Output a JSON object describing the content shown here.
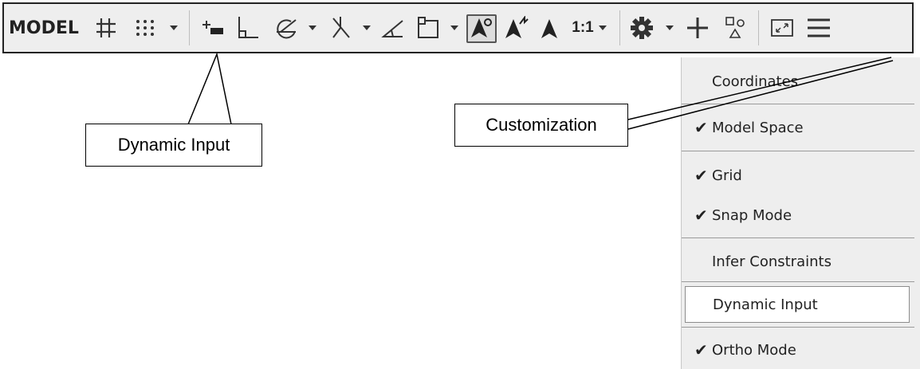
{
  "statusbar": {
    "model_label": "MODEL",
    "scale_label": "1:1",
    "tools": [
      {
        "name": "grid-icon"
      },
      {
        "name": "snap-mode-icon"
      },
      {
        "name": "dropdown-arrow-icon"
      },
      {
        "name": "dynamic-input-icon"
      },
      {
        "name": "ortho-mode-icon"
      },
      {
        "name": "polar-tracking-icon"
      },
      {
        "name": "isodraft-icon"
      },
      {
        "name": "object-snap-tracking-icon"
      },
      {
        "name": "object-snap-icon"
      },
      {
        "name": "annotation-visibility-icon"
      },
      {
        "name": "auto-scale-icon"
      },
      {
        "name": "annotation-scale-icon"
      },
      {
        "name": "workspace-switching-icon"
      },
      {
        "name": "annotation-monitor-icon"
      },
      {
        "name": "isolate-objects-icon"
      },
      {
        "name": "clean-screen-icon"
      },
      {
        "name": "customization-menu-icon"
      }
    ]
  },
  "menu": {
    "items": [
      {
        "label": "Coordinates",
        "checked": false,
        "check_mark": ""
      },
      {
        "label": "Model Space",
        "checked": true,
        "check_mark": "✔"
      },
      {
        "label": "Grid",
        "checked": true,
        "check_mark": "✔"
      },
      {
        "label": "Snap Mode",
        "checked": true,
        "check_mark": "✔"
      },
      {
        "label": "Infer Constraints",
        "checked": false,
        "check_mark": ""
      },
      {
        "label": "Dynamic Input",
        "checked": false,
        "check_mark": "",
        "highlighted": true
      },
      {
        "label": "Ortho Mode",
        "checked": true,
        "check_mark": "✔"
      }
    ]
  },
  "callouts": {
    "dynamic_input": "Dynamic Input",
    "customization": "Customization"
  }
}
